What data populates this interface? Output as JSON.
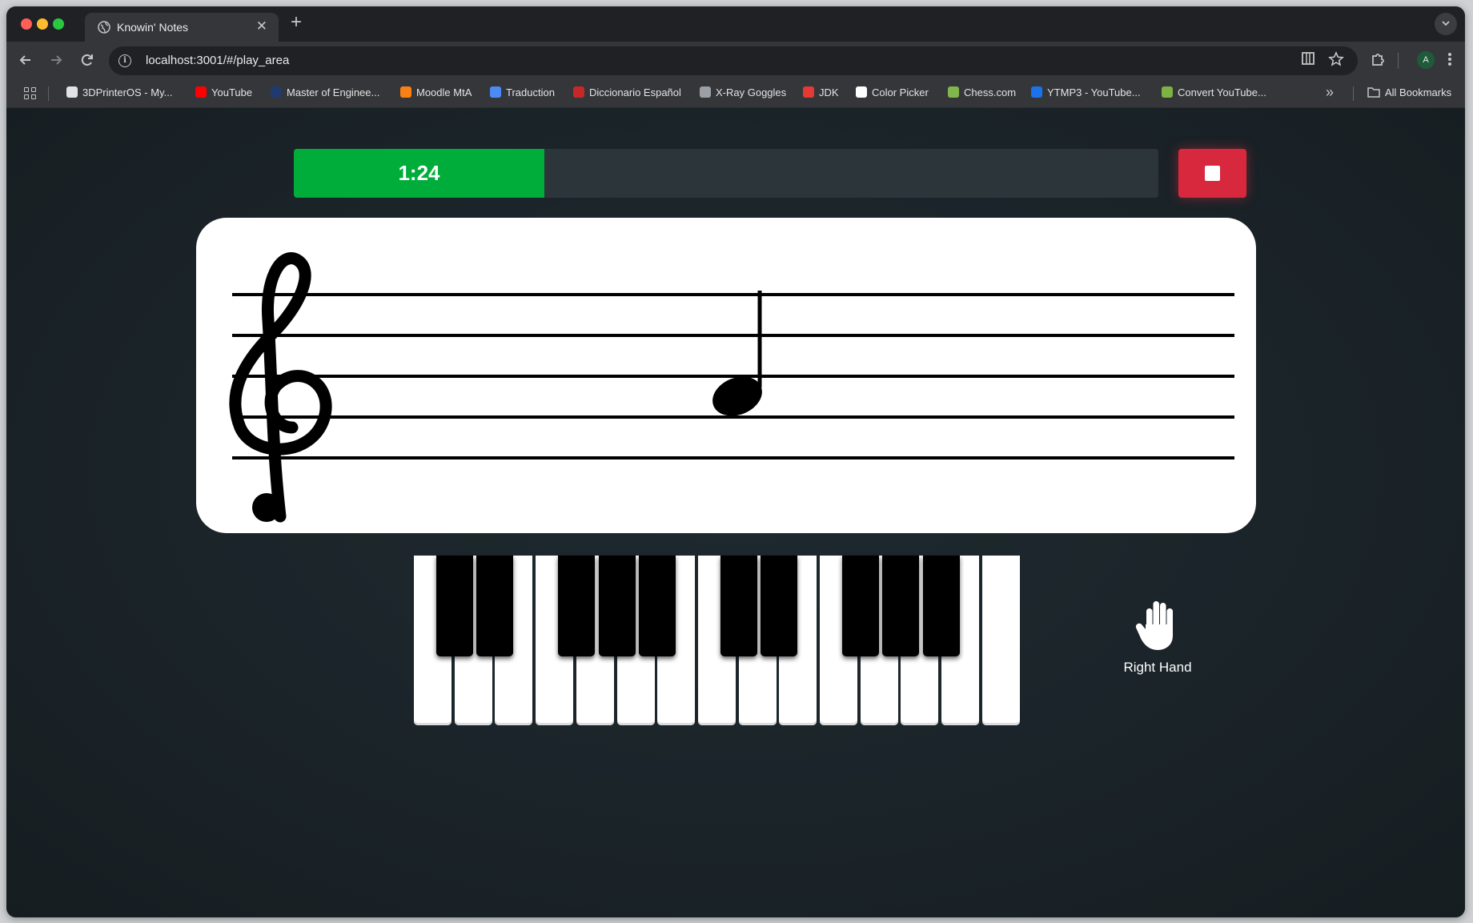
{
  "browser": {
    "tab_title": "Knowin' Notes",
    "tab_close": "✕",
    "new_tab": "+",
    "url": "localhost:3001/#/play_area",
    "avatar_initial": "A",
    "bookmarks": [
      {
        "label": "3DPrinterOS - My...",
        "icon": "printer-os-icon",
        "color": "#dfe3e8"
      },
      {
        "label": "YouTube",
        "icon": "youtube-icon",
        "color": "#ff0000"
      },
      {
        "label": "Master of Enginee...",
        "icon": "university-icon",
        "color": "#1e3a6e"
      },
      {
        "label": "Moodle MtA",
        "icon": "moodle-icon",
        "color": "#f98012"
      },
      {
        "label": "Traduction",
        "icon": "translate-icon",
        "color": "#4c8bf5"
      },
      {
        "label": "Diccionario Español",
        "icon": "rae-icon",
        "color": "#c62828"
      },
      {
        "label": "X-Ray Goggles",
        "icon": "globe-icon",
        "color": "#9aa0a6"
      },
      {
        "label": "JDK",
        "icon": "oracle-icon",
        "color": "#e53935"
      },
      {
        "label": "Color Picker",
        "icon": "google-icon",
        "color": "#ffffff"
      },
      {
        "label": "Chess.com",
        "icon": "chess-pawn-icon",
        "color": "#81b64c"
      },
      {
        "label": "YTMP3 - YouTube...",
        "icon": "ytmp3-icon",
        "color": "#1a73e8"
      },
      {
        "label": "Convert YouTube...",
        "icon": "download-arrow-icon",
        "color": "#7cb342"
      }
    ],
    "all_bookmarks": "All Bookmarks"
  },
  "game": {
    "timer_label": "1:24",
    "timer_progress": 0.29,
    "stop_icon": "stop-square-icon",
    "clef": "treble-clef",
    "note": {
      "type": "quarter",
      "staff_line_from_bottom": 2,
      "stem": "up"
    },
    "keyboard": {
      "white_keys": 15,
      "black_key_groups": [
        2,
        3,
        2,
        3
      ]
    },
    "hand_label": "Right Hand",
    "hand_icon": "hand-icon"
  },
  "colors": {
    "timer_fill": "#00ad3a",
    "stop_button": "#d8283d",
    "background": "#1b2227"
  }
}
